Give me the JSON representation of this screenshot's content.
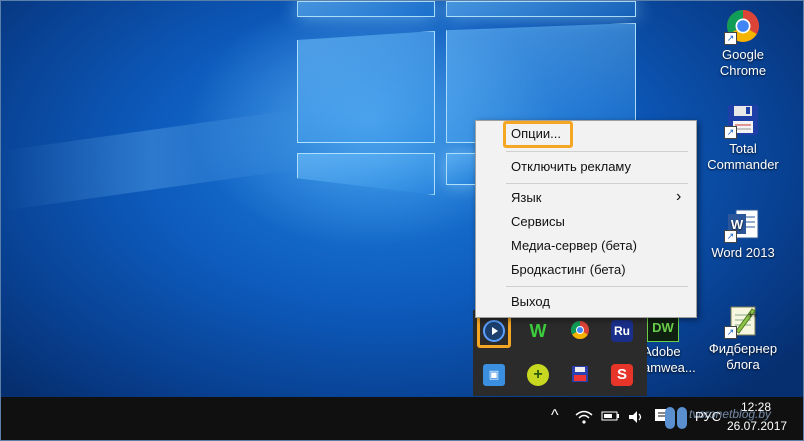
{
  "desktop_icons": [
    {
      "label": "Google Chrome",
      "icon": "chrome-icon"
    },
    {
      "label": "Total Commander",
      "icon": "floppy-icon"
    },
    {
      "label": "Word 2013",
      "icon": "word-icon"
    },
    {
      "label": "Фидбернер блога",
      "icon": "notepad-plus-icon"
    }
  ],
  "partial_icon": {
    "line1": "Adobe",
    "line2": "amwea..."
  },
  "context_menu": {
    "items": [
      {
        "label": "Опции..."
      },
      {
        "label": "Отключить рекламу"
      },
      {
        "label": "Язык",
        "submenu_arrow": "›"
      },
      {
        "label": "Сервисы"
      },
      {
        "label": "Медиа-сервер (бета)"
      },
      {
        "label": "Бродкастинг (бета)"
      },
      {
        "label": "Выход"
      }
    ],
    "highlight_color": "#f5a623"
  },
  "tray_overflow": {
    "row1": [
      "mediaget-icon",
      "wunderlist-icon",
      "chrome-icon",
      "ru-icon"
    ],
    "row2": [
      "app-icon",
      "plus-icon",
      "floppy-icon",
      "snagit-icon"
    ],
    "ru_label": "Ru",
    "w_label": "W",
    "s_label": "S"
  },
  "taskbar": {
    "chevron": "^",
    "lang_fragment": "РУС",
    "time": "12:28",
    "date": "26.07.2017",
    "watermark": "tvoronetblog.by"
  }
}
